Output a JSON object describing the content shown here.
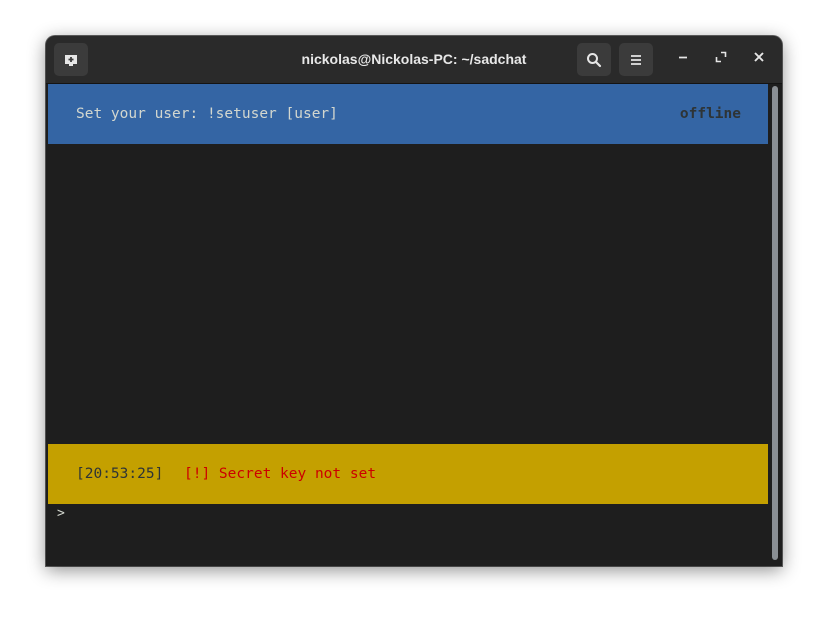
{
  "window": {
    "title": "nickolas@Nickolas-PC: ~/sadchat"
  },
  "titlebar": {
    "new_tab_icon": "new-tab-icon",
    "search_icon": "search-icon",
    "menu_icon": "hamburger-menu-icon",
    "minimize_icon": "minimize-icon",
    "maximize_icon": "maximize-icon",
    "close_icon": "close-icon"
  },
  "terminal": {
    "header": {
      "text": "Set your user: !setuser [user]",
      "status": "offline",
      "color": "#3465a4"
    },
    "notice": {
      "time": "[20:53:25]",
      "message": "[!] Secret key not set",
      "color": "#c4a000",
      "message_color": "#cc0000"
    },
    "prompt": ">",
    "background": "#1e1e1e"
  }
}
